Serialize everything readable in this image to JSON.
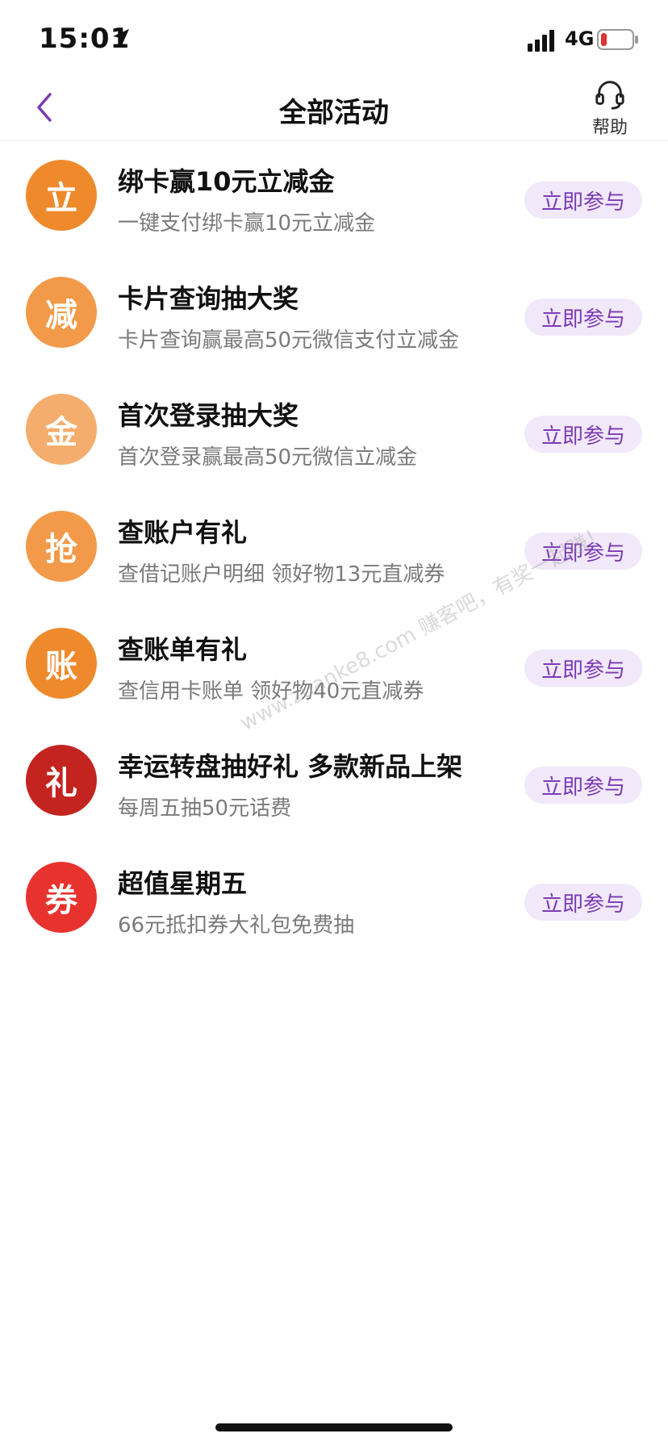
{
  "status_bar": {
    "time": "15:01",
    "network": "4G",
    "battery_color": "#e03030"
  },
  "nav": {
    "title": "全部活动",
    "help_label": "帮助",
    "accent_color": "#7b3bb4"
  },
  "activities": [
    {
      "badge": "立",
      "badge_color": "#ee8a2c",
      "title": "绑卡赢10元立减金",
      "subtitle": "一键支付绑卡赢10元立减金",
      "button": "立即参与"
    },
    {
      "badge": "减",
      "badge_color": "#f29a4a",
      "title": "卡片查询抽大奖",
      "subtitle": "卡片查询赢最高50元微信支付立减金",
      "button": "立即参与"
    },
    {
      "badge": "金",
      "badge_color": "#f4ad6c",
      "title": "首次登录抽大奖",
      "subtitle": "首次登录赢最高50元微信立减金",
      "button": "立即参与"
    },
    {
      "badge": "抢",
      "badge_color": "#f29a4a",
      "title": "查账户有礼",
      "subtitle": "查借记账户明细 领好物13元直减券",
      "button": "立即参与"
    },
    {
      "badge": "账",
      "badge_color": "#ee8a2c",
      "title": "查账单有礼",
      "subtitle": "查信用卡账单 领好物40元直减券",
      "button": "立即参与"
    },
    {
      "badge": "礼",
      "badge_color": "#c42420",
      "title": "幸运转盘抽好礼  多款新品上架",
      "subtitle": "每周五抽50元话费",
      "button": "立即参与"
    },
    {
      "badge": "券",
      "badge_color": "#e8322e",
      "title": "超值星期五",
      "subtitle": "66元抵扣券大礼包免费抽",
      "button": "立即参与"
    }
  ],
  "watermark": "www.zuanke8.com 赚客吧，有奖一起赚！",
  "icons": {
    "back": "chevron-left-icon",
    "help": "headset-icon",
    "location": "location-arrow-icon",
    "signal": "signal-icon",
    "battery": "battery-icon"
  }
}
